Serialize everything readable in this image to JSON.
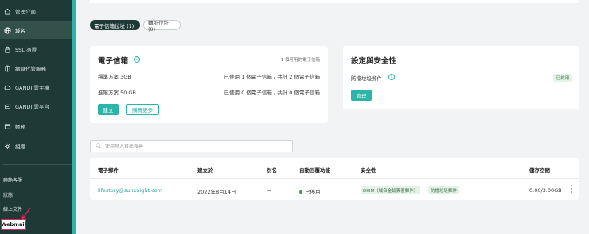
{
  "sidebar": {
    "items": [
      {
        "label": "管理介面",
        "icon": "home-icon"
      },
      {
        "label": "域名",
        "icon": "globe-icon"
      },
      {
        "label": "SSL 憑證",
        "icon": "lock-icon"
      },
      {
        "label": "網頁代管服務",
        "icon": "server-icon"
      },
      {
        "label": "GANDI 雲主機",
        "icon": "cloud-icon"
      },
      {
        "label": "GANDI 雲平台",
        "icon": "cloud-platform-icon"
      },
      {
        "label": "帳務",
        "icon": "billing-icon"
      },
      {
        "label": "組織",
        "icon": "gear-icon"
      }
    ],
    "active_index": 1,
    "bottom_links": [
      "聯絡客服",
      "狀態",
      "線上文件"
    ],
    "webmail_label": "Webmail"
  },
  "tabs": {
    "active": "電子信箱位址 (1)",
    "inactive": "轉址位址 (0)"
  },
  "email_card": {
    "title": "電子信箱",
    "note": "1 個可用的電子信箱",
    "plans": [
      {
        "name": "標準方案 3GB",
        "usage": "已使用 1 個電子信箱 / 共計 2 個電子信箱"
      },
      {
        "name": "進階方案 50 GB",
        "usage": "已使用 0 個電子信箱 / 共計 0 個電子信箱"
      }
    ],
    "create_button": "建立",
    "buy_more_button": "購買更多"
  },
  "security_card": {
    "title": "設定與安全性",
    "antispam_label": "防擋垃圾郵件",
    "status": "已啟用",
    "manage_button": "管理"
  },
  "search": {
    "placeholder": "使用登入資訊搜尋"
  },
  "table": {
    "headers": [
      "電子郵件",
      "建立於",
      "別名",
      "自動回覆功能",
      "安全性",
      "儲存空間"
    ],
    "rows": [
      {
        "email": "lifestory@sunxnight.com",
        "created": "2022年8月14日",
        "alias": "—",
        "autoreply": "已停用",
        "security_tags": [
          "DKIM（域名金鑰簽署郵件）",
          "防擋垃圾郵件"
        ],
        "storage": "0.00/3.00GB"
      }
    ]
  },
  "colors": {
    "sidebar_bg": "#1f3a36",
    "accent": "#2bb5a8",
    "highlight_box": "#e0245e"
  }
}
